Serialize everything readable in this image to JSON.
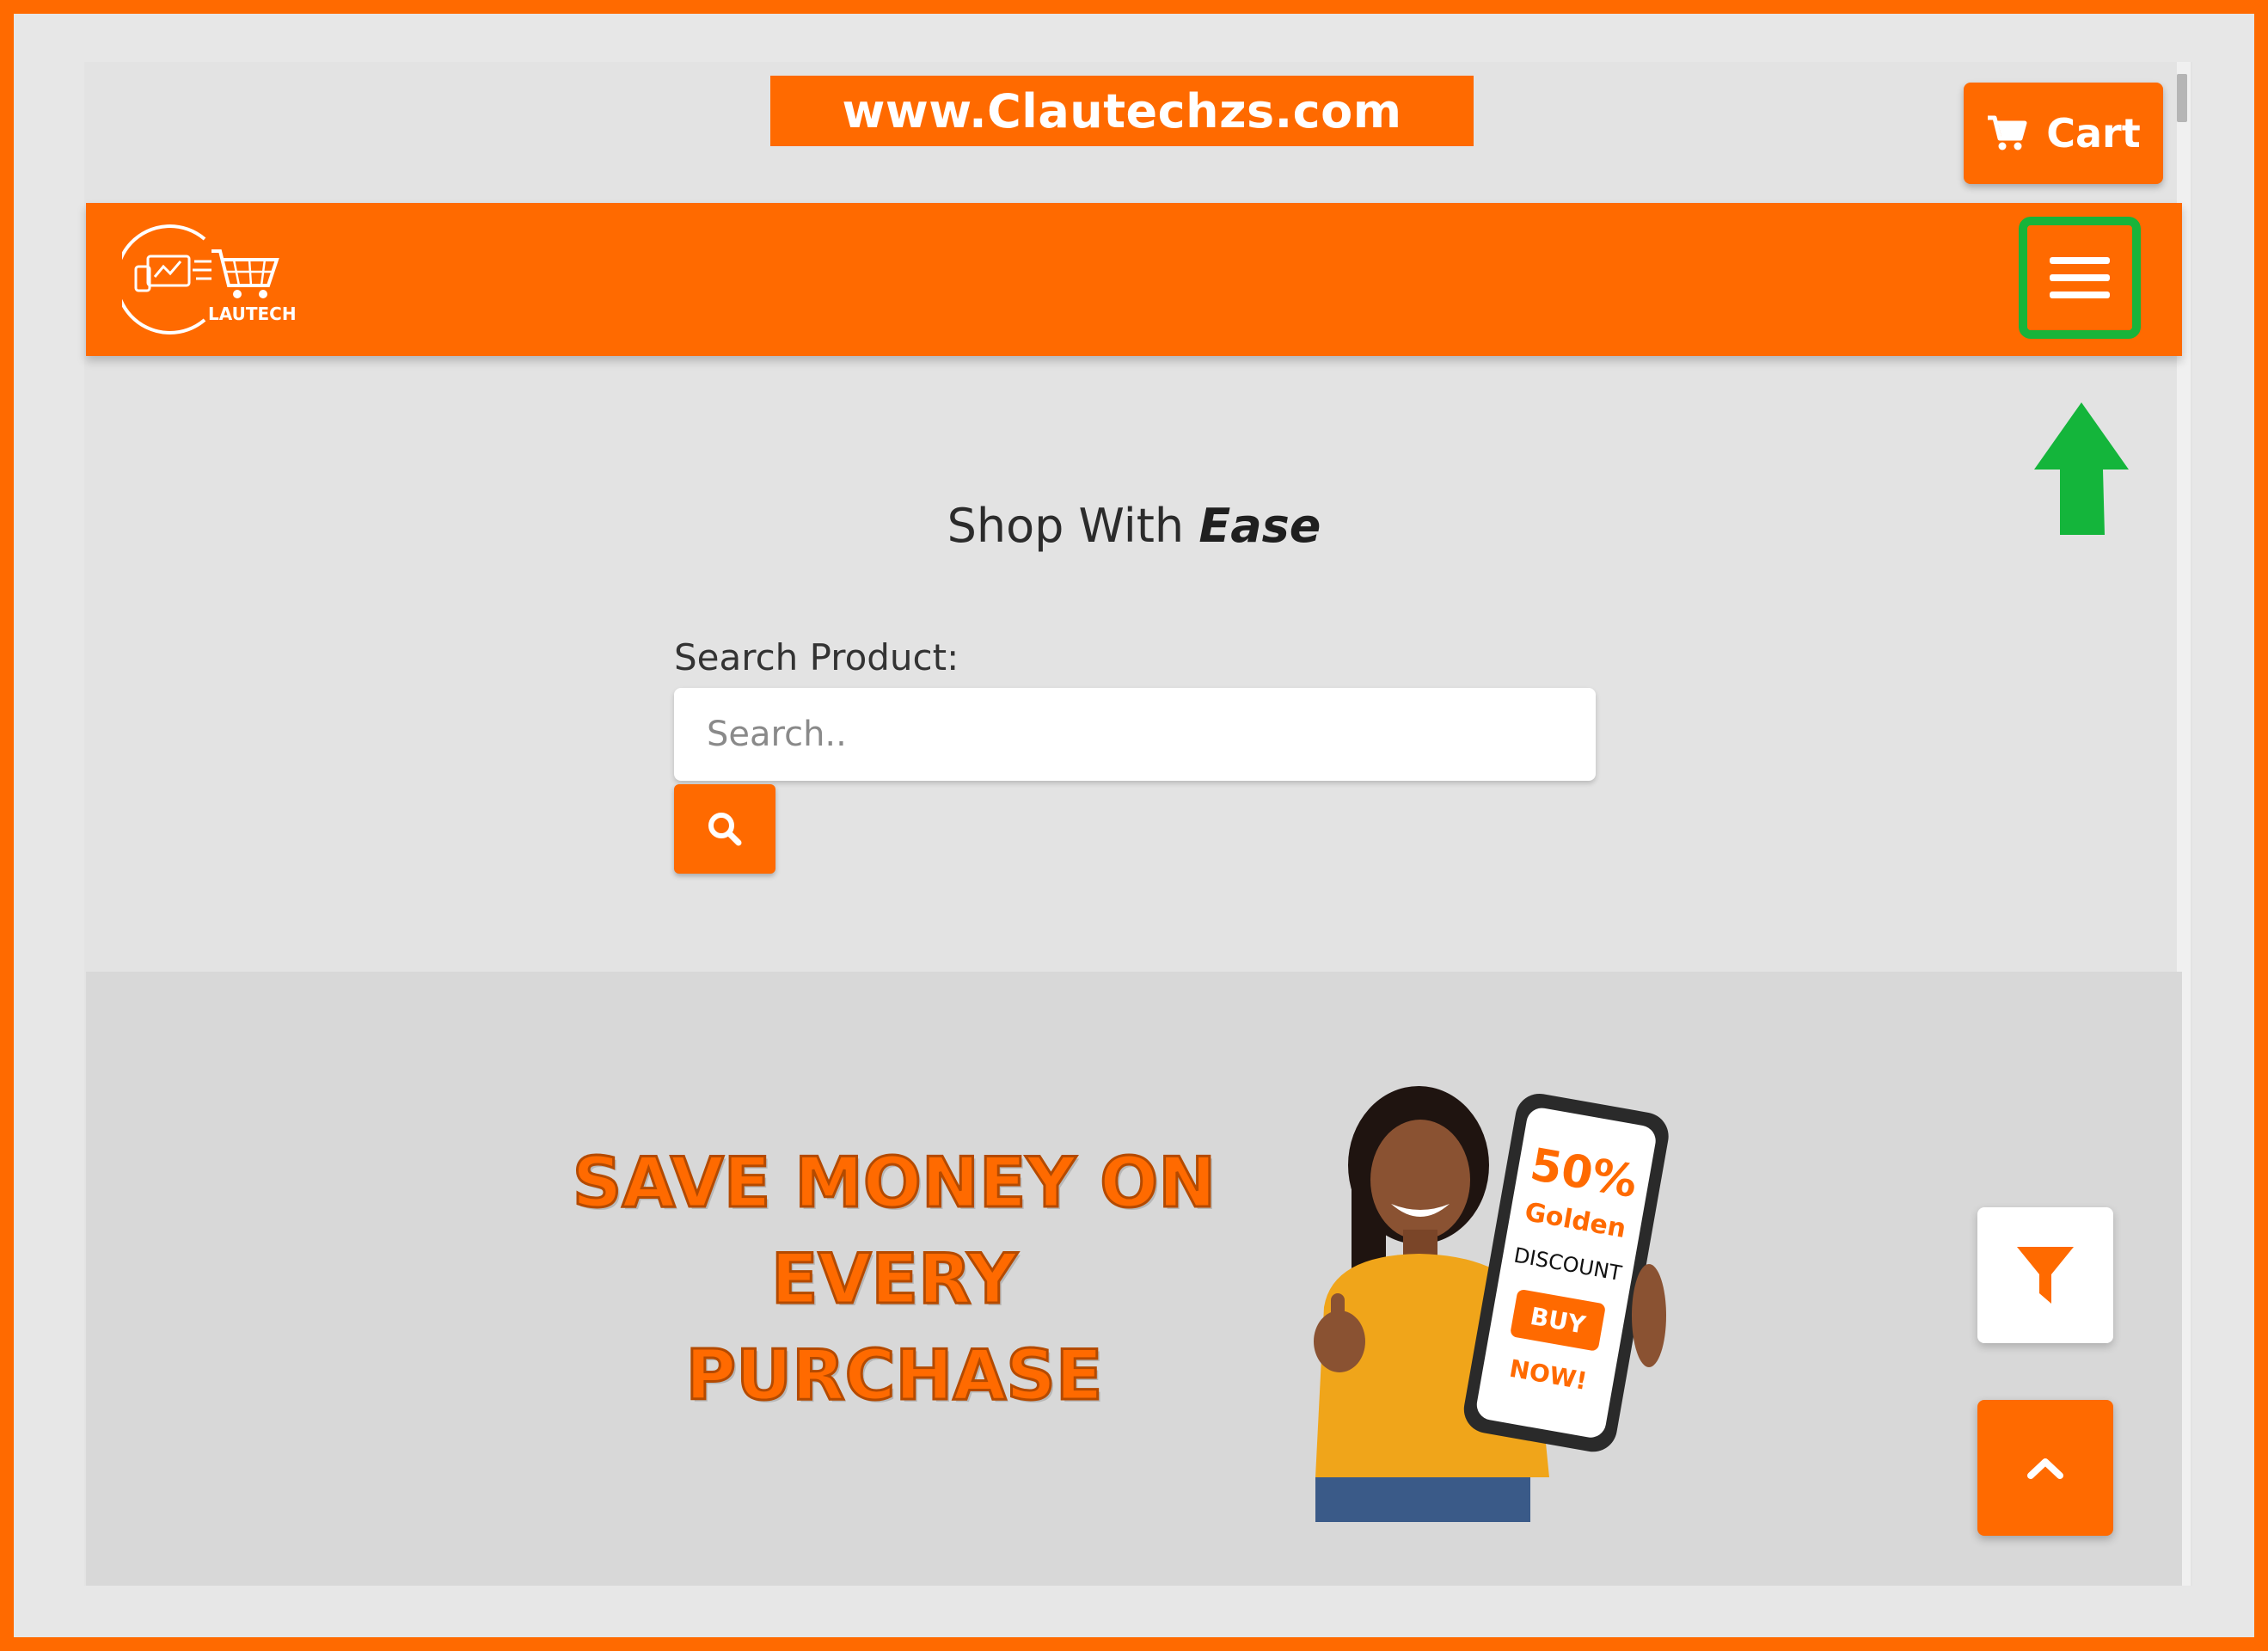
{
  "banner": {
    "url_text": "www.Clautechzs.com"
  },
  "header": {
    "cart_label": "Cart",
    "logo_text": "LAUTECH"
  },
  "hero": {
    "title_prefix": "Shop With ",
    "title_emphasis": "Ease"
  },
  "search": {
    "label": "Search Product:",
    "placeholder": "Search..",
    "value": ""
  },
  "promo": {
    "line1": "SAVE MONEY ON",
    "line2": "EVERY",
    "line3": "PURCHASE",
    "phone_percent": "50%",
    "phone_golden": "Golden",
    "phone_discount": "DISCOUNT",
    "phone_buy": "BUY",
    "phone_now": "NOW!"
  },
  "colors": {
    "brand": "#ff6a00",
    "highlight": "#18b43a",
    "background": "#e3e3e3"
  },
  "icons": {
    "cart": "cart-icon",
    "menu": "hamburger-menu-icon",
    "search": "search-icon",
    "filter": "filter-icon",
    "scroll_top": "chevron-up-icon",
    "pointer": "arrow-up-icon"
  }
}
